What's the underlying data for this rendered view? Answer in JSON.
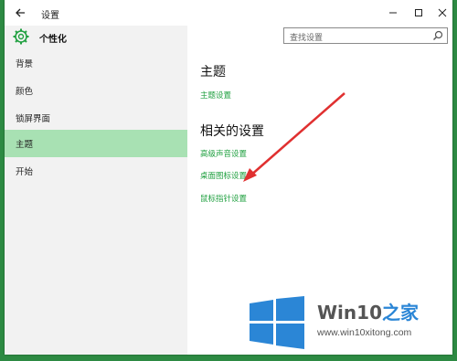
{
  "window": {
    "title": "设置",
    "page_title": "个性化"
  },
  "search": {
    "placeholder": "查找设置"
  },
  "sidebar": {
    "items": [
      {
        "label": "背景"
      },
      {
        "label": "颜色"
      },
      {
        "label": "锁屏界面"
      },
      {
        "label": "主题",
        "active": true
      },
      {
        "label": "开始"
      }
    ]
  },
  "content": {
    "section1": {
      "heading": "主题",
      "links": [
        "主题设置"
      ]
    },
    "section2": {
      "heading": "相关的设置",
      "links": [
        "高级声音设置",
        "桌面图标设置",
        "鼠标指针设置"
      ]
    }
  },
  "watermark": {
    "brand_prefix": "Win10",
    "brand_suffix": "之家",
    "url": "www.win10xitong.com"
  },
  "colors": {
    "accent": "#20a040",
    "active_bg": "#a8e1b3",
    "arrow": "#e03030",
    "brand": "#2b86d6"
  }
}
